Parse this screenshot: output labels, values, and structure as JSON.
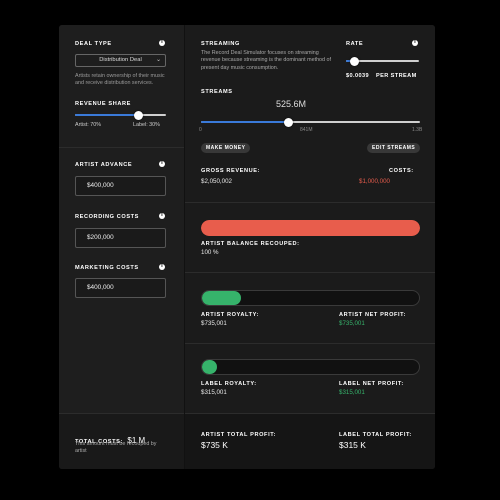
{
  "left": {
    "deal_type": {
      "label": "DEAL TYPE",
      "selected": "Distribution Deal",
      "description": "Artists retain ownership of their music and receive distribution services."
    },
    "revenue_share": {
      "label": "REVENUE SHARE",
      "artist": "Artist: 70%",
      "label_share": "Label: 30%",
      "artist_fraction": 0.7
    },
    "artist_advance": {
      "label": "ARTIST ADVANCE",
      "value": "$400,000"
    },
    "recording_costs": {
      "label": "RECORDING COSTS",
      "value": "$200,000"
    },
    "marketing_costs": {
      "label": "MARKETING COSTS",
      "value": "$400,000"
    },
    "total_costs": {
      "label": "TOTAL COSTS:",
      "value": "$1 M",
      "note": "This amount must be recouped by artist"
    }
  },
  "right": {
    "streaming": {
      "label": "STREAMING",
      "description": "The Record Deal Simulator focuses on streaming revenue because streaming is the dominant method of present day music consumption."
    },
    "rate": {
      "label": "RATE",
      "value": "$0.0039",
      "unit": "PER STREAM",
      "fraction": 0.12
    },
    "streams": {
      "label": "STREAMS",
      "value": "525.6M",
      "tick_min": "0",
      "tick_mid": "841M",
      "tick_max": "1.3B",
      "fraction": 0.4
    },
    "buttons": {
      "make_money": "MAKE MONEY",
      "edit_streams": "EDIT STREAMS"
    },
    "gross_revenue": {
      "label": "GROSS REVENUE:",
      "value": "$2,050,002"
    },
    "costs": {
      "label": "COSTS:",
      "value": "$1,000,000"
    },
    "recoup": {
      "label": "ARTIST BALANCE RECOUPED:",
      "value": "100 %",
      "fraction": 1.0,
      "color": "#e85d4c"
    },
    "artist_bar": {
      "fraction": 0.18,
      "color": "#36b36b"
    },
    "artist_royalty": {
      "label": "ARTIST ROYALTY:",
      "value": "$735,001"
    },
    "artist_net_profit": {
      "label": "ARTIST NET PROFIT:",
      "value": "$735,001"
    },
    "label_bar": {
      "fraction": 0.07,
      "color": "#36b36b"
    },
    "label_royalty": {
      "label": "LABEL ROYALTY:",
      "value": "$315,001"
    },
    "label_net_profit": {
      "label": "LABEL NET PROFIT:",
      "value": "$315,001"
    },
    "artist_total_profit": {
      "label": "ARTIST TOTAL PROFIT:",
      "value": "$735 K"
    },
    "label_total_profit": {
      "label": "LABEL TOTAL PROFIT:",
      "value": "$315 K"
    }
  },
  "icons": {
    "info": "i"
  }
}
